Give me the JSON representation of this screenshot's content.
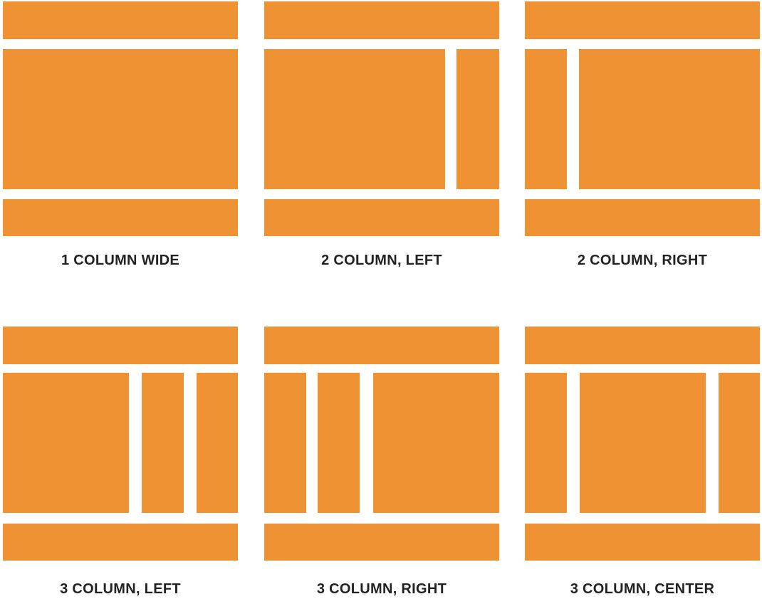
{
  "colors": {
    "block": "#ee9234",
    "caption_text": "#222222",
    "background": "#ffffff"
  },
  "layouts": [
    {
      "caption": "1 COLUMN WIDE"
    },
    {
      "caption": "2 COLUMN, LEFT"
    },
    {
      "caption": "2 COLUMN, RIGHT"
    },
    {
      "caption": "3 COLUMN, LEFT"
    },
    {
      "caption": "3 COLUMN, RIGHT"
    },
    {
      "caption": "3 COLUMN, CENTER"
    }
  ]
}
